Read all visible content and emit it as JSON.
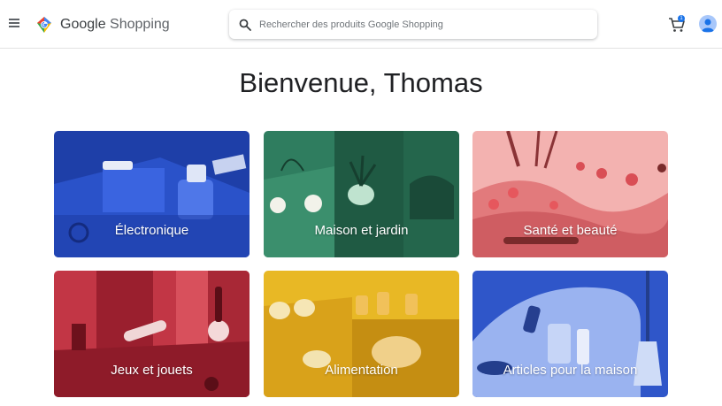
{
  "header": {
    "logo_word_google": "Google",
    "logo_word_shopping": "Shopping",
    "search_placeholder": "Rechercher des produits Google Shopping",
    "cart_count": "1"
  },
  "welcome": "Bienvenue, Thomas",
  "categories": [
    {
      "label": "Électronique"
    },
    {
      "label": "Maison et jardin"
    },
    {
      "label": "Santé et beauté"
    },
    {
      "label": "Jeux et jouets"
    },
    {
      "label": "Alimentation"
    },
    {
      "label": "Articles pour la maison"
    }
  ],
  "colors": {
    "electronics": "#1e3fa8",
    "home_garden": "#2f7d5f",
    "health_beauty": "#e88d8d",
    "toys": "#b3283a",
    "food": "#d9a21a",
    "household": "#4a6fd1"
  },
  "icons": [
    "menu-icon",
    "search-icon",
    "cart-icon",
    "avatar-icon"
  ]
}
